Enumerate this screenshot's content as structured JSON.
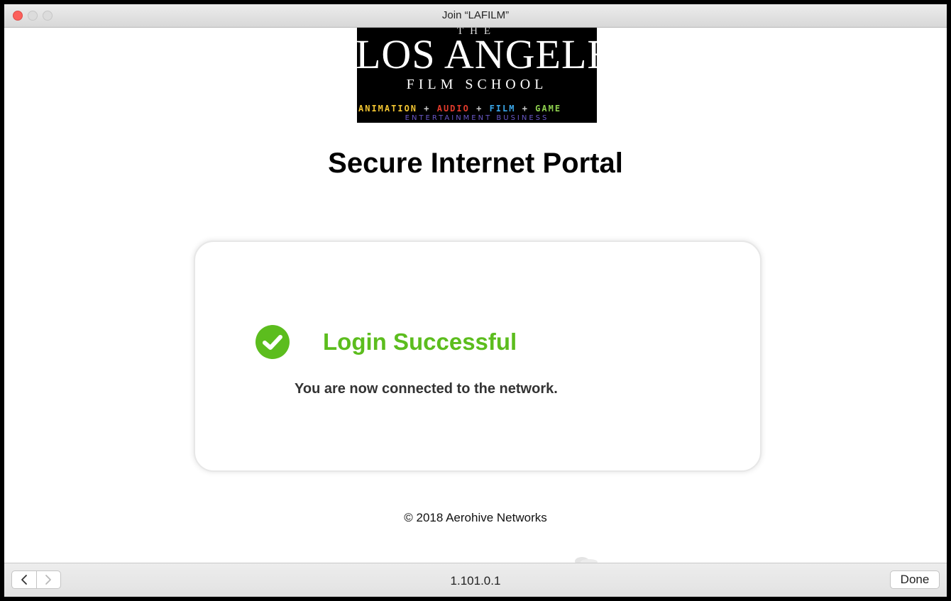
{
  "window": {
    "title": "Join “LAFILM”"
  },
  "logo": {
    "the": "THE",
    "main": "LOS ANGELES",
    "sub": "FILM SCHOOL",
    "tags": {
      "animation": "ANIMATION",
      "plus": "+",
      "audio": "AUDIO",
      "film": "FILM",
      "game": "GAME"
    },
    "entertainment": "ENTERTAINMENT BUSINESS"
  },
  "page": {
    "heading": "Secure Internet Portal",
    "status_title": "Login Successful",
    "status_message": "You are now connected to the network.",
    "copyright": "© 2018 Aerohive Networks"
  },
  "toolbar": {
    "back_icon": "chevron-left-icon",
    "forward_icon": "chevron-right-icon",
    "address": "1.101.0.1",
    "done_label": "Done"
  },
  "colors": {
    "success_green": "#5cbd1e",
    "close_red": "#fc605b"
  }
}
